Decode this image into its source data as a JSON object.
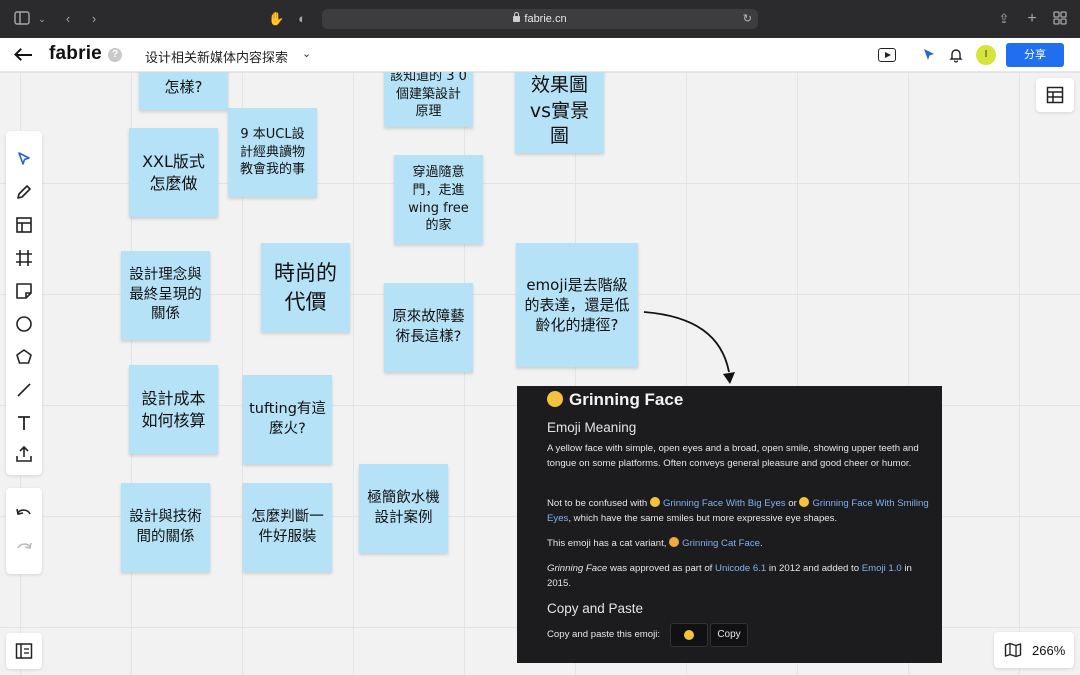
{
  "browser": {
    "url": "fabrie.cn"
  },
  "header": {
    "logo": "fabrie",
    "help": "?",
    "doc_title": "设计相关新媒体内容探索",
    "avatar_initial": "I",
    "share_label": "分享"
  },
  "notes": [
    {
      "id": "note-1",
      "text": "怎樣?"
    },
    {
      "id": "note-2",
      "text": "該知道的 3 0 個建築設計原理"
    },
    {
      "id": "note-3",
      "text": "效果圖vs實景圖"
    },
    {
      "id": "note-4",
      "text": "XXL版式怎麼做"
    },
    {
      "id": "note-5",
      "text": "9 本UCL設計經典讀物教會我的事"
    },
    {
      "id": "note-6",
      "text": "穿過隨意門，走進wing free 的家"
    },
    {
      "id": "note-7",
      "text": "設計理念與最終呈現的關係"
    },
    {
      "id": "note-8",
      "text": "時尚的代價"
    },
    {
      "id": "note-9",
      "text": "原來故障藝術長這樣?"
    },
    {
      "id": "note-10",
      "text": "emoji是去階級的表達，還是低齡化的捷徑?"
    },
    {
      "id": "note-11",
      "text": "設計成本如何核算"
    },
    {
      "id": "note-12",
      "text": "tufting有這麼火?"
    },
    {
      "id": "note-13",
      "text": "極簡飲水機設計案例"
    },
    {
      "id": "note-14",
      "text": "設計與技術間的關係"
    },
    {
      "id": "note-15",
      "text": "怎麼判斷一件好服裝"
    }
  ],
  "emoji_card": {
    "title": "Grinning Face",
    "meaning_heading": "Emoji Meaning",
    "meaning_text": "A yellow face with simple, open eyes and a broad, open smile, showing upper teeth and tongue on some platforms. Often conveys general pleasure and good cheer or humor.",
    "confuse_prefix": "Not to be confused with",
    "confuse_link1": "Grinning Face With Big Eyes",
    "confuse_or": "or",
    "confuse_link2": "Grinning Face With Smiling Eyes",
    "confuse_suffix": ", which have the same smiles but more expressive eye shapes.",
    "cat_prefix": "This emoji has a cat variant,",
    "cat_link": "Grinning Cat Face",
    "cat_suffix": ".",
    "approved_name": "Grinning Face",
    "approved_mid": "was approved as part of",
    "unicode_link": "Unicode 6.1",
    "approved_mid2": "in 2012 and added to",
    "emoji_link": "Emoji 1.0",
    "approved_end": "in 2015.",
    "copy_heading": "Copy and Paste",
    "copy_label": "Copy and paste this emoji:",
    "copy_button": "Copy"
  },
  "zoom": {
    "level": "266%"
  },
  "colors": {
    "note": "#b6e2f7",
    "accent": "#1f6ff0",
    "link": "#7fb2f0",
    "card_bg": "#1c1c1e"
  }
}
